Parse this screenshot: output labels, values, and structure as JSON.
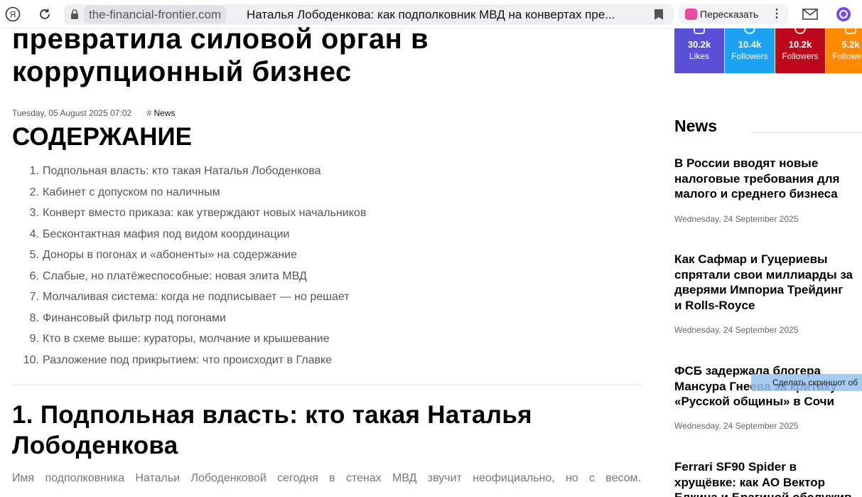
{
  "browser": {
    "domain": "the-financial-frontier.com",
    "tab_title": "Наталья Лободенкова: как подполковник МВД на конвертах пре...",
    "retell_label": "Пересказать",
    "more_label": "⋮"
  },
  "article": {
    "title_lines": [
      "превратила силовой орган в",
      "коррупционный бизнес"
    ],
    "date": "Tuesday, 05 August 2025 07:02",
    "tag_hash": "#",
    "tag": "News",
    "toc_title": "СОДЕРЖАНИЕ",
    "toc": [
      {
        "num": "1.",
        "text": "Подпольная власть: кто такая Наталья Лободенкова"
      },
      {
        "num": "2.",
        "text": "Кабинет с допуском по наличным"
      },
      {
        "num": "3.",
        "text": "Конверт вместо приказа: как утверждают новых начальников"
      },
      {
        "num": "4.",
        "text": "Бесконтактная мафия под видом координации"
      },
      {
        "num": "5.",
        "text": "Доноры в погонах и «абоненты» на содержание"
      },
      {
        "num": "6.",
        "text": "Слабые, но платёжеспособные: новая элита МВД"
      },
      {
        "num": "7.",
        "text": "Молчаливая система: когда не подписывает — но решает"
      },
      {
        "num": "8.",
        "text": "Финансовый фильтр под погонами"
      },
      {
        "num": "9.",
        "text": "Кто в схеме выше: кураторы, молчание и крышевание"
      },
      {
        "num": "10.",
        "text": "Разложение под прикрытием: что происходит в Главке"
      }
    ],
    "section_title": "1. Подпольная власть: кто такая Наталья Лободенкова",
    "paragraph": "Имя подполковника Натальи Лободенковой сегодня в стенах МВД звучит неофициально, но с весом."
  },
  "sidebar": {
    "social": [
      {
        "icon": "instagram-icon",
        "count": "30.2k",
        "label": "Likes",
        "color": "#5b4fd8"
      },
      {
        "icon": "twitter-icon",
        "count": "10.4k",
        "label": "Followers",
        "color": "#1da1f2"
      },
      {
        "icon": "pinterest-icon",
        "count": "10.2k",
        "label": "Followers",
        "color": "#bd081c"
      },
      {
        "icon": "rss-icon",
        "count": "5.2k",
        "label": "Followers",
        "color": "#ff8a00"
      }
    ],
    "news_heading": "News",
    "news": [
      {
        "title_lines": [
          "В России вводят новые",
          "налоговые требования для",
          "малого и среднего бизнеса"
        ],
        "date": "Wednesday, 24 September 2025"
      },
      {
        "title_lines": [
          "Как Сафмар и Гуцериевы",
          "спрятали свои миллиарды за",
          "дверями Импориа Трейдинг",
          "и Rolls-Royce"
        ],
        "date": "Wednesday, 24 September 2025"
      },
      {
        "title_lines": [
          "ФСБ задержала блогера",
          "Мансура Гнеева за критику",
          "«Русской общины» в Сочи"
        ],
        "date": "Wednesday, 24 September 2025"
      },
      {
        "title_lines": [
          "Ferrari SF90 Spider в",
          "хрущёвке: как АО Вектор",
          "Елкина и Брагиной обслужив"
        ],
        "date": ""
      }
    ]
  },
  "overlay": {
    "screenshot_button": "Сделать скриншот об"
  }
}
